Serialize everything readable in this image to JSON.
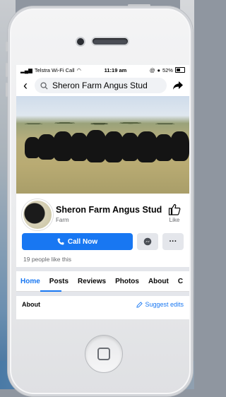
{
  "status_bar": {
    "carrier": "Telstra Wi-Fi Call",
    "time": "11:19 am",
    "battery": "52%"
  },
  "search": {
    "query": "Sheron Farm Angus Stud"
  },
  "page": {
    "name": "Sheron Farm Angus Stud",
    "category": "Farm",
    "like_label": "Like",
    "call_button": "Call Now",
    "more_label": "···",
    "likes_text": "19 people like this"
  },
  "tabs": [
    "Home",
    "Posts",
    "Reviews",
    "Photos",
    "About",
    "C"
  ],
  "about": {
    "title": "About",
    "suggest_edits": "Suggest edits"
  },
  "colors": {
    "accent": "#1877f2",
    "text": "#050505",
    "muted": "#65676b"
  }
}
